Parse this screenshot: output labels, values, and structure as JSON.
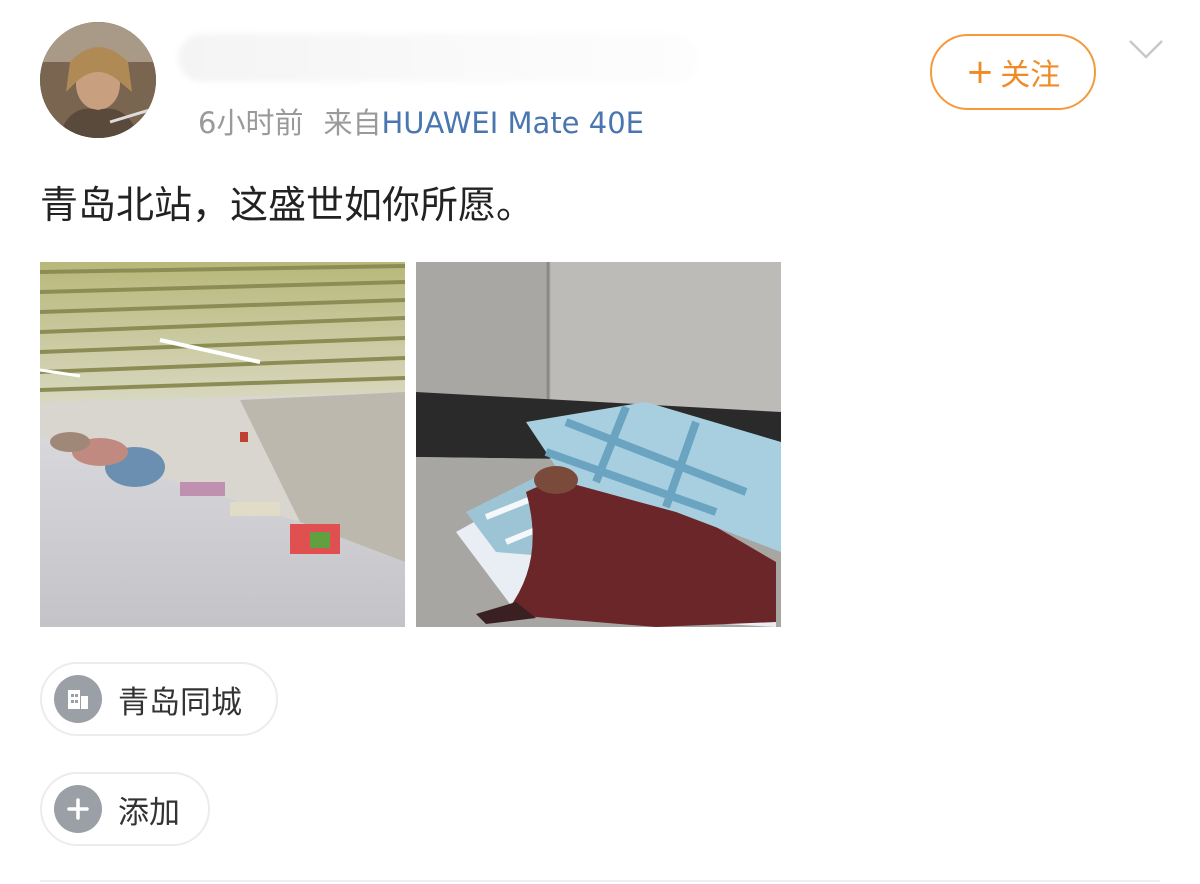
{
  "post": {
    "meta": {
      "time": "6小时前",
      "source_prefix": "来自",
      "device": "HUAWEI Mate 40E"
    },
    "follow_button": {
      "label": "关注",
      "icon": "plus-icon"
    },
    "menu_icon": "chevron-down-icon",
    "text": "青岛北站，这盛世如你所愿。",
    "images": [
      {
        "subject": "underground-passage-with-tents"
      },
      {
        "subject": "person-sleeping-under-blanket"
      }
    ],
    "tags": [
      {
        "label": "青岛同城",
        "icon": "city-building-icon"
      },
      {
        "label": "添加",
        "icon": "plus-circle-icon"
      }
    ]
  },
  "colors": {
    "follow_accent": "#f08a24",
    "device_link": "#4a76b0",
    "meta_gray": "#9a9a9a"
  }
}
